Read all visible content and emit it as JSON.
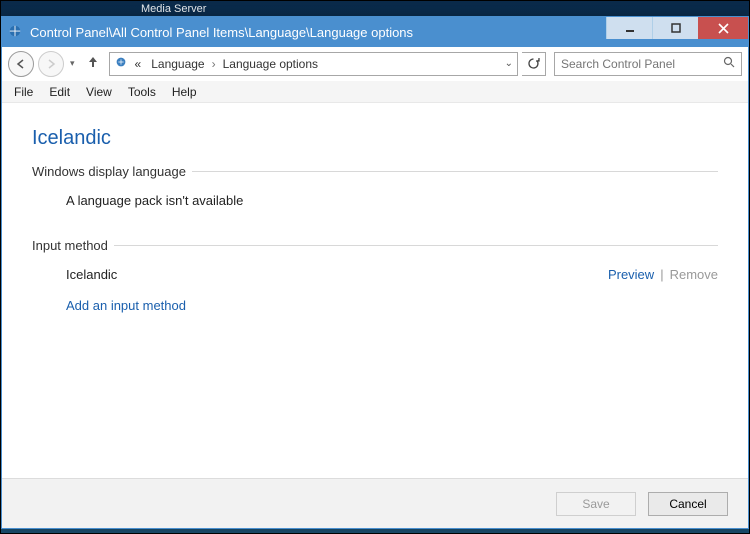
{
  "desktop": {
    "icon_label": "Media Server"
  },
  "titlebar": {
    "title": "Control Panel\\All Control Panel Items\\Language\\Language options"
  },
  "address": {
    "prefix": "«",
    "crumb1": "Language",
    "crumb2": "Language options"
  },
  "search": {
    "placeholder": "Search Control Panel"
  },
  "menu": {
    "file": "File",
    "edit": "Edit",
    "view": "View",
    "tools": "Tools",
    "help": "Help"
  },
  "page": {
    "title": "Icelandic",
    "section1_label": "Windows display language",
    "section1_text": "A language pack isn't available",
    "section2_label": "Input method",
    "input_name": "Icelandic",
    "preview": "Preview",
    "remove": "Remove",
    "add_link": "Add an input method"
  },
  "footer": {
    "save": "Save",
    "cancel": "Cancel"
  }
}
